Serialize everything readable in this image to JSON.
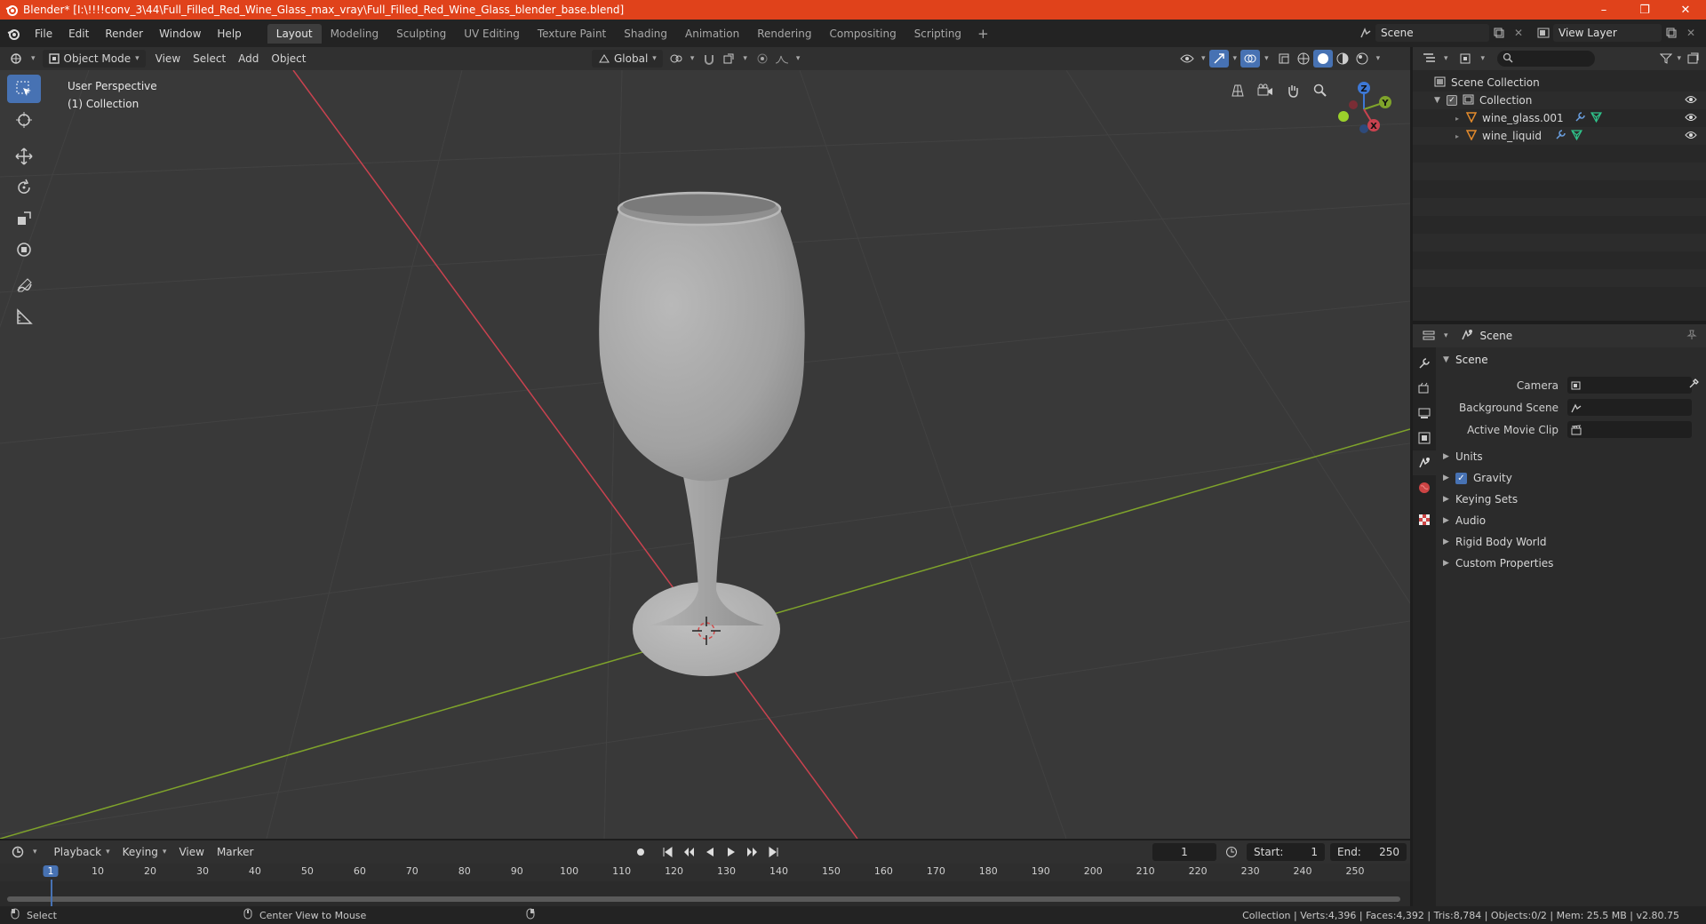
{
  "window": {
    "title": "Blender* [I:\\!!!!conv_3\\44\\Full_Filled_Red_Wine_Glass_max_vray\\Full_Filled_Red_Wine_Glass_blender_base.blend]",
    "controls": [
      "–",
      "❐",
      "✕"
    ]
  },
  "menu": {
    "items": [
      "File",
      "Edit",
      "Render",
      "Window",
      "Help"
    ]
  },
  "workspaces": {
    "tabs": [
      "Layout",
      "Modeling",
      "Sculpting",
      "UV Editing",
      "Texture Paint",
      "Shading",
      "Animation",
      "Rendering",
      "Compositing",
      "Scripting"
    ],
    "active": "Layout",
    "add_label": "+"
  },
  "scene_selector": {
    "value": "Scene"
  },
  "view_layer_selector": {
    "value": "View Layer"
  },
  "viewport_header": {
    "mode": "Object Mode",
    "menus": [
      "View",
      "Select",
      "Add",
      "Object"
    ],
    "orientation": "Global"
  },
  "viewport": {
    "perspective_label": "User Perspective",
    "collection_label": "(1) Collection",
    "axes": {
      "x": "X",
      "y": "Y",
      "z": "Z"
    },
    "colors": {
      "x_axis": "#c9424f",
      "y_axis": "#7fa32b",
      "z_axis": "#3d78d6",
      "background": "#393939",
      "glass": "#a9a9a9"
    }
  },
  "outliner": {
    "search_placeholder": "",
    "root": "Scene Collection",
    "collection": "Collection",
    "objects": [
      {
        "name": "wine_glass.001"
      },
      {
        "name": "wine_liquid"
      }
    ]
  },
  "properties": {
    "context": "Scene",
    "panel_title": "Scene",
    "fields": [
      {
        "label": "Camera",
        "value": ""
      },
      {
        "label": "Background Scene",
        "value": ""
      },
      {
        "label": "Active Movie Clip",
        "value": ""
      }
    ],
    "subpanels": [
      {
        "label": "Units",
        "checkbox": false
      },
      {
        "label": "Gravity",
        "checkbox": true
      },
      {
        "label": "Keying Sets",
        "checkbox": false
      },
      {
        "label": "Audio",
        "checkbox": false
      },
      {
        "label": "Rigid Body World",
        "checkbox": false
      },
      {
        "label": "Custom Properties",
        "checkbox": false
      }
    ]
  },
  "timeline": {
    "menus": [
      "Playback",
      "Keying",
      "View",
      "Marker"
    ],
    "current_frame": "1",
    "start_label": "Start:",
    "start_value": "1",
    "end_label": "End:",
    "end_value": "250",
    "ticks": [
      "1",
      "10",
      "20",
      "30",
      "40",
      "50",
      "60",
      "70",
      "80",
      "90",
      "100",
      "110",
      "120",
      "130",
      "140",
      "150",
      "160",
      "170",
      "180",
      "190",
      "200",
      "210",
      "220",
      "230",
      "240",
      "250"
    ]
  },
  "statusbar": {
    "left_action": "Select",
    "middle_action": "Center View to Mouse",
    "stats": "Collection | Verts:4,396 | Faces:4,392 | Tris:8,784 | Objects:0/2 | Mem: 25.5 MB | v2.80.75"
  }
}
